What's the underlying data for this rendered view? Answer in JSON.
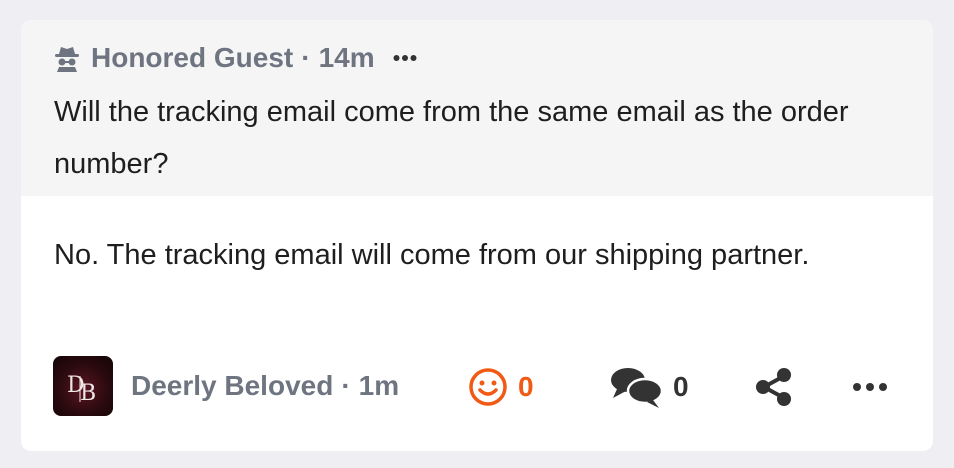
{
  "question": {
    "author": "Honored Guest",
    "time": "14m",
    "separator": "·",
    "text": "Will the tracking email come from the same email as the order number?"
  },
  "answer": {
    "text": "No. The tracking email will come from our shipping partner.",
    "author": "Deerly Beloved",
    "time": "1m",
    "separator": "·",
    "avatar_initials": "DB",
    "reaction_count": "0",
    "comment_count": "0"
  },
  "icons": {
    "author_icon": "incognito-spy-icon",
    "reaction_icon": "smiley-icon",
    "comment_icon": "comments-icon",
    "share_icon": "share-icon",
    "more_icon": "more-horizontal-icon"
  },
  "colors": {
    "accent": "#f05a14",
    "muted_text": "#6e7480",
    "question_bg": "#f5f5f6"
  }
}
